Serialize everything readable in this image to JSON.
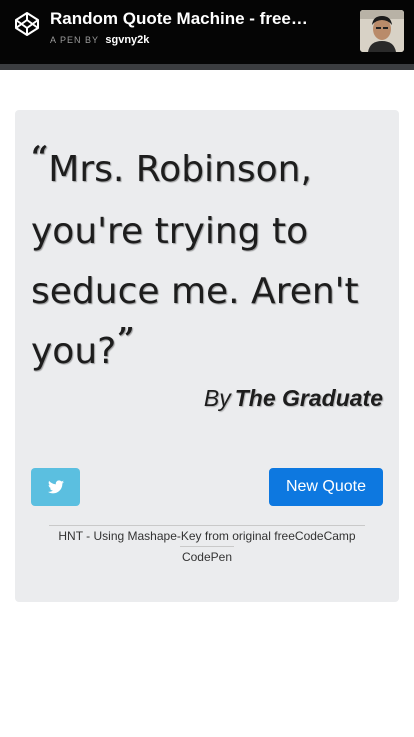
{
  "header": {
    "title": "Random Quote Machine - freeCodeCamp",
    "byline_prefix": "A PEN BY",
    "author": "sgvny2k"
  },
  "quote": {
    "open_mark": "“",
    "close_mark": "”",
    "text": "Mrs. Robinson, you're trying to seduce me. Aren't you?",
    "by_prefix": "By",
    "author": "The Graduate"
  },
  "actions": {
    "tweet_icon": "twitter-icon",
    "new_quote_label": "New Quote"
  },
  "footer": {
    "line1": "HNT - Using Mashape-Key from original freeCodeCamp",
    "line2": "CodePen"
  },
  "colors": {
    "header_bg": "#050505",
    "card_bg": "#ebecee",
    "tweet_bg": "#5bbfe0",
    "primary_button": "#0d78e0"
  }
}
